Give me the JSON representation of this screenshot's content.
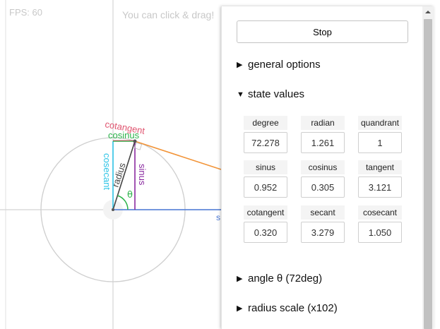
{
  "overlay": {
    "fps": "FPS: 60",
    "hint": "You can click & drag!"
  },
  "diagram": {
    "labels": {
      "cotangent": "cotangent",
      "cosinus": "cosinus",
      "cosecant": "cosecant",
      "radius": "radius",
      "sinus": "sinus",
      "theta": "θ",
      "secant_partial": "s"
    },
    "colors": {
      "cotangent": "#e05570",
      "cosinus": "#2bb34a",
      "cosecant": "#2ec4e6",
      "sinus": "#8a2aa0",
      "tangent": "#f29438",
      "secant": "#4a78d6",
      "radius": "#444444",
      "circle": "#cfcfcf",
      "axes": "#d4d4d4"
    }
  },
  "panel": {
    "stop_label": "Stop",
    "sections": {
      "general": "general options",
      "state": "state values",
      "angle": "angle θ (72deg)",
      "radius": "radius scale (x102)"
    },
    "state_values": [
      {
        "label": "degree",
        "value": "72.278"
      },
      {
        "label": "radian",
        "value": "1.261"
      },
      {
        "label": "quandrant",
        "value": "1"
      },
      {
        "label": "sinus",
        "value": "0.952"
      },
      {
        "label": "cosinus",
        "value": "0.305"
      },
      {
        "label": "tangent",
        "value": "3.121"
      },
      {
        "label": "cotangent",
        "value": "0.320"
      },
      {
        "label": "secant",
        "value": "3.279"
      },
      {
        "label": "cosecant",
        "value": "1.050"
      }
    ]
  },
  "icons": {
    "collapsed": "triangle-right-icon",
    "expanded": "triangle-down-icon",
    "scroll_up": "chevron-up-icon"
  }
}
